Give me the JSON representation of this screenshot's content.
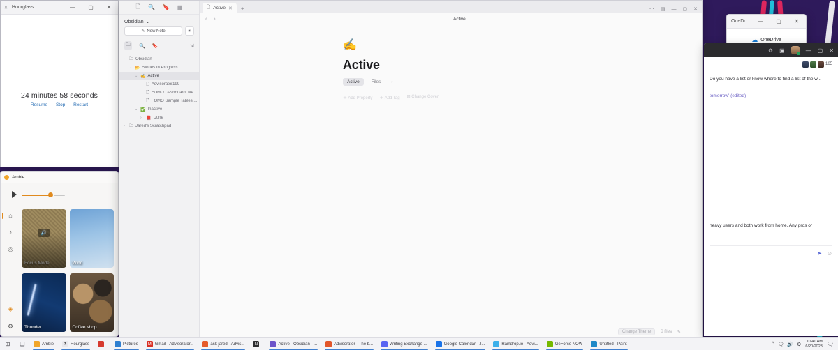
{
  "desktop": {
    "wallpaper_colors": [
      "#2f1a5c",
      "#e8275f",
      "#21c7e0",
      "#f5f5f5"
    ]
  },
  "hourglass": {
    "title": "Hourglass",
    "time_text": "24 minutes 58 seconds",
    "actions": [
      "Resume",
      "Stop",
      "Restart"
    ],
    "window_buttons": [
      "minimize",
      "maximize",
      "close"
    ]
  },
  "ambie": {
    "title": "Ambie",
    "play_label": "play-button",
    "volume_percent": 62,
    "rail_icons": [
      "home-icon",
      "music-note-icon",
      "compass-icon",
      "pin-icon",
      "gear-icon"
    ],
    "sounds": [
      {
        "label": "Focus Mode",
        "playing": true
      },
      {
        "label": "Wind",
        "playing": false
      },
      {
        "label": "Thunder",
        "playing": false
      },
      {
        "label": "Coffee shop",
        "playing": false
      }
    ]
  },
  "obsidian": {
    "sidebar": {
      "top_icons": [
        "new-note-icon",
        "search-icon",
        "bookmark-icon",
        "grid-icon"
      ],
      "vault_name": "Obsidian",
      "vault_chevron": "⌄",
      "new_note_label": "New Note",
      "sidebar_toggle_label": "☀",
      "tool_icons": [
        "files-icon",
        "search-icon",
        "bookmarks-icon",
        "collapse-icon"
      ],
      "tree": [
        {
          "level": 0,
          "arrow": "›",
          "icon": "folder",
          "label": "Obsidian",
          "selected": false
        },
        {
          "level": 1,
          "arrow": "⌄",
          "icon": "folder",
          "label": "Stories In Progress",
          "selected": false
        },
        {
          "level": 2,
          "arrow": "⌄",
          "icon": "pencil",
          "label": "Active",
          "selected": true
        },
        {
          "level": 3,
          "arrow": "",
          "icon": "file",
          "label": "Advisorator199",
          "selected": false
        },
        {
          "level": 3,
          "arrow": "",
          "icon": "file",
          "label": "FOMO Dashboard, Ne...",
          "selected": false
        },
        {
          "level": 3,
          "arrow": "",
          "icon": "file",
          "label": "FOMO Sample Tables ...",
          "selected": false
        },
        {
          "level": 2,
          "arrow": "⌄",
          "icon": "check",
          "label": "Inactive",
          "selected": false
        },
        {
          "level": 3,
          "arrow": "›",
          "icon": "book",
          "label": "Done",
          "selected": false
        },
        {
          "level": 0,
          "arrow": "›",
          "icon": "folder",
          "label": "Jared's Scratchpad",
          "selected": false
        }
      ]
    },
    "tabs": [
      {
        "label": "Active",
        "close": "✕",
        "active": true
      }
    ],
    "new_tab_label": "+",
    "tab_right_icons": [
      "minimize-icon",
      "restore-icon",
      "close-icon"
    ],
    "navbar": {
      "back": "‹",
      "forward": "›",
      "breadcrumb": "Active"
    },
    "document": {
      "emoji": "✍️",
      "title": "Active",
      "view_tabs": [
        {
          "label": "Active",
          "active": true
        },
        {
          "label": "Files",
          "active": false
        },
        {
          "label": "›",
          "active": false
        }
      ],
      "property_actions": [
        "＋ Add Property",
        "＋ Add Tag",
        "⊞ Change Cover"
      ]
    },
    "status": {
      "theme_label": "Change Theme",
      "files_label": "0 files",
      "edit_icon": "✎"
    }
  },
  "onedrive": {
    "title": "OneDrive",
    "label": "OneDrive",
    "window_buttons": [
      "minimize",
      "maximize",
      "close"
    ]
  },
  "dark_window": {
    "titlebar_icons": [
      "history-icon",
      "panel-icon",
      "avatar",
      "minimize-icon",
      "restore-icon",
      "close-icon"
    ],
    "member_count": "165",
    "message_top": "Do you have a list or know where to find a list of the w...",
    "edited_line": "tomorrow' (edited)",
    "message_bottom": "heavy users and both work from home.    Any pros or",
    "send_icon": "➤",
    "emoji_icon": "☺"
  },
  "taskbar": {
    "start_icon": "⊞",
    "taskview_icon": "❏",
    "items": [
      {
        "label": "Ambie",
        "color": "#f0a52a",
        "glyph": "●",
        "active": true
      },
      {
        "label": "Hourglass",
        "color": "#e8e8ec",
        "glyph": "⏳",
        "active": true
      },
      {
        "label": "",
        "color": "#d63a2f",
        "glyph": "◉",
        "active": false
      },
      {
        "label": "Pictures",
        "color": "#2f7fd0",
        "glyph": "▤",
        "active": true
      },
      {
        "label": "Gmail - Advisorator...",
        "color": "#d93025",
        "glyph": "M",
        "active": true
      },
      {
        "label": "ask jared - Advis...",
        "color": "#e55b2b",
        "glyph": "◆",
        "active": true
      },
      {
        "label": "",
        "color": "#2b2b2e",
        "glyph": "N",
        "active": false
      },
      {
        "label": "Active - Obsidian - ...",
        "color": "#6c53c9",
        "glyph": "◈",
        "active": true
      },
      {
        "label": "Advisorator - The b...",
        "color": "#e2562a",
        "glyph": "🦁",
        "active": true
      },
      {
        "label": "Writing Exchange ...",
        "color": "#5865f2",
        "glyph": "▣",
        "active": true
      },
      {
        "label": "Google Calendar - J...",
        "color": "#1a73e8",
        "glyph": "31",
        "active": true
      },
      {
        "label": "Raindrop.io - Advi...",
        "color": "#3db0ea",
        "glyph": "☁",
        "active": true
      },
      {
        "label": "GeForce NOW",
        "color": "#76b900",
        "glyph": "▰",
        "active": true
      },
      {
        "label": "Untitled - Paint",
        "color": "#1e88c7",
        "glyph": "🎨",
        "active": true
      }
    ],
    "tray_icons": [
      "^",
      "💬",
      "🔊",
      "⚙"
    ],
    "clock_time": "10:41 AM",
    "clock_date": "6/20/2023",
    "notification_icon": "🗨"
  }
}
